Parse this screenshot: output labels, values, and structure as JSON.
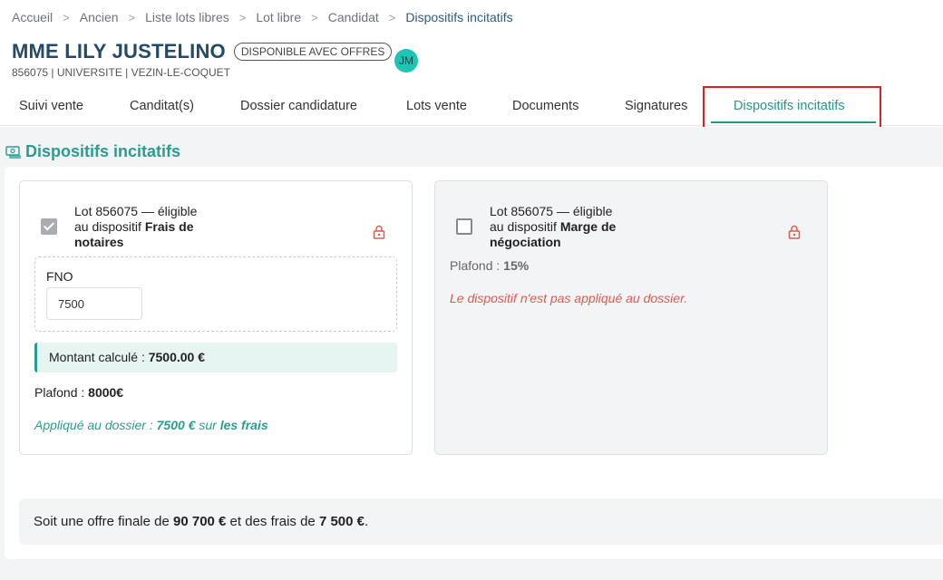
{
  "breadcrumb": {
    "items": [
      {
        "label": "Accueil"
      },
      {
        "label": "Ancien"
      },
      {
        "label": "Liste lots libres"
      },
      {
        "label": "Lot libre"
      },
      {
        "label": "Candidat"
      },
      {
        "label": "Dispositifs incitatifs"
      }
    ]
  },
  "header": {
    "title": "MME LILY JUSTELINO",
    "status": "DISPONIBLE AVEC OFFRES",
    "avatar_initials": "JM",
    "subtitle": "856075 | UNIVERSITE | VEZIN-LE-COQUET"
  },
  "tabs": [
    {
      "label": "Suivi vente"
    },
    {
      "label": "Canditat(s)"
    },
    {
      "label": "Dossier candidature"
    },
    {
      "label": "Lots vente"
    },
    {
      "label": "Documents"
    },
    {
      "label": "Signatures"
    },
    {
      "label": "Dispositifs incitatifs"
    }
  ],
  "section": {
    "title": "Dispositifs incitatifs"
  },
  "cards": [
    {
      "lot_line": "Lot 856075 — éligible",
      "dispositif_prefix": "au dispositif ",
      "dispositif_name": "Frais de notaires",
      "field_label": "FNO",
      "field_value": "7500",
      "calc_label": "Montant calculé : ",
      "calc_value": "7500.00 €",
      "plafond_label": "Plafond : ",
      "plafond_value": "8000€",
      "applied_prefix": "Appliqué au dossier : ",
      "applied_amount": "7500 €",
      "applied_mid": " sur ",
      "applied_target": "les frais"
    },
    {
      "lot_line": "Lot 856075 — éligible",
      "dispositif_prefix": "au dispositif ",
      "dispositif_name": "Marge de négociation",
      "plafond_label": "Plafond : ",
      "plafond_value": "15%",
      "not_applied": "Le dispositif n'est pas appliqué au dossier."
    }
  ],
  "summary": {
    "prefix": "Soit une offre finale de ",
    "offer": "90 700 €",
    "mid": " et des frais de ",
    "fees": "7 500 €",
    "suffix": "."
  },
  "colors": {
    "accent": "#2a9d8f",
    "title": "#234a66",
    "error": "#e05a4e",
    "highlight": "#e02020"
  }
}
